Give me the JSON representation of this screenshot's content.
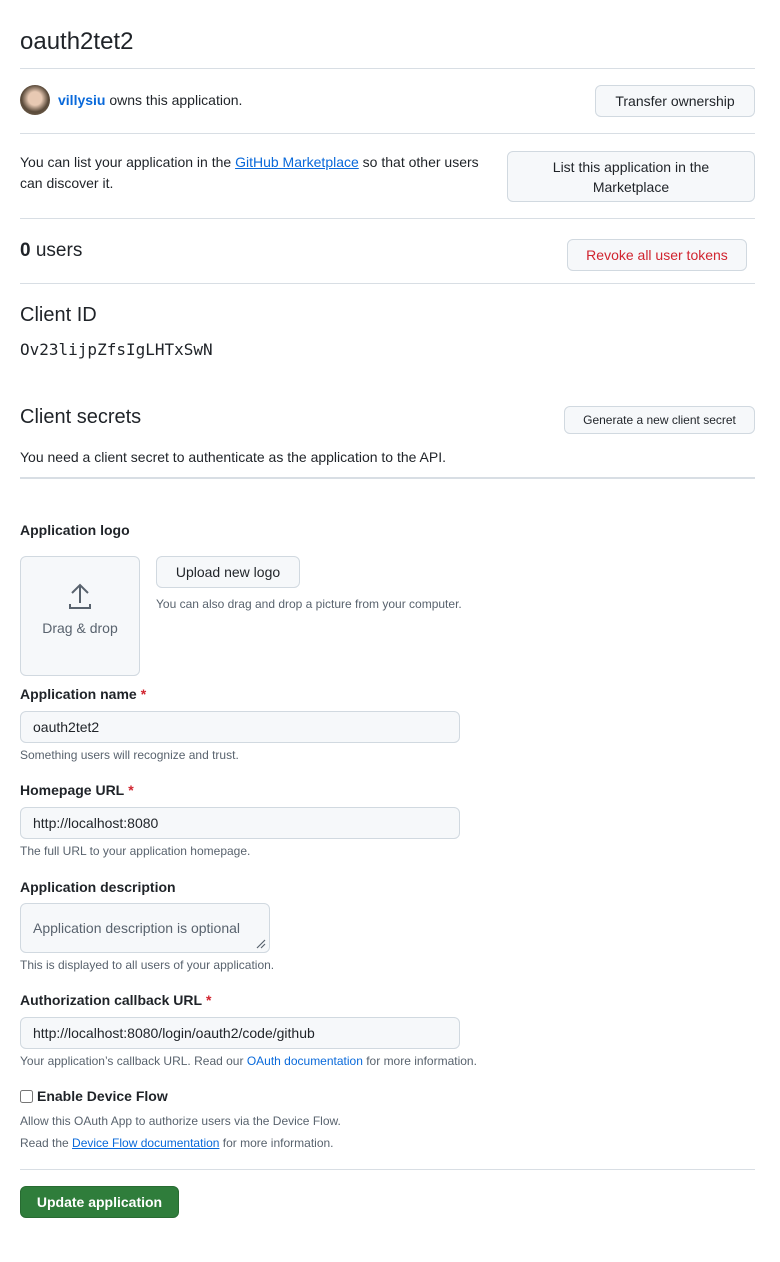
{
  "title": "oauth2tet2",
  "owner": {
    "username": "villysiu",
    "text": " owns this application.",
    "transfer_label": "Transfer ownership"
  },
  "marketplace": {
    "pre": "You can list your application in the ",
    "link": "GitHub Marketplace",
    "post": " so that other users can discover it.",
    "button": "List this application in the Marketplace"
  },
  "users": {
    "count": "0",
    "label": " users",
    "revoke_label": "Revoke all user tokens"
  },
  "client_id": {
    "heading": "Client ID",
    "value": "Ov23lijpZfsIgLHTxSwN"
  },
  "client_secrets": {
    "heading": "Client secrets",
    "generate_label": "Generate a new client secret",
    "description": "You need a client secret to authenticate as the application to the API."
  },
  "logo": {
    "label": "Application logo",
    "drag_drop": "Drag & drop",
    "upload_label": "Upload new logo",
    "hint": "You can also drag and drop a picture from your computer."
  },
  "form": {
    "name": {
      "label": "Application name",
      "required": "*",
      "value": "oauth2tet2",
      "hint": "Something users will recognize and trust."
    },
    "homepage": {
      "label": "Homepage URL",
      "required": "*",
      "value": "http://localhost:8080",
      "hint": "The full URL to your application homepage."
    },
    "description": {
      "label": "Application description",
      "placeholder": "Application description is optional",
      "hint": "This is displayed to all users of your application."
    },
    "callback": {
      "label": "Authorization callback URL",
      "required": "*",
      "value": "http://localhost:8080/login/oauth2/code/github",
      "hint_pre": "Your application’s callback URL. Read our ",
      "hint_link": "OAuth documentation",
      "hint_post": " for more information."
    },
    "device_flow": {
      "label": "Enable Device Flow",
      "checked": false,
      "line1": "Allow this OAuth App to authorize users via the Device Flow.",
      "line2_pre": "Read the ",
      "line2_link": "Device Flow documentation",
      "line2_post": " for more information."
    }
  },
  "update_label": "Update application",
  "colors": {
    "link": "#0969da",
    "danger": "#d1242f",
    "primary": "#2f7d3b"
  }
}
